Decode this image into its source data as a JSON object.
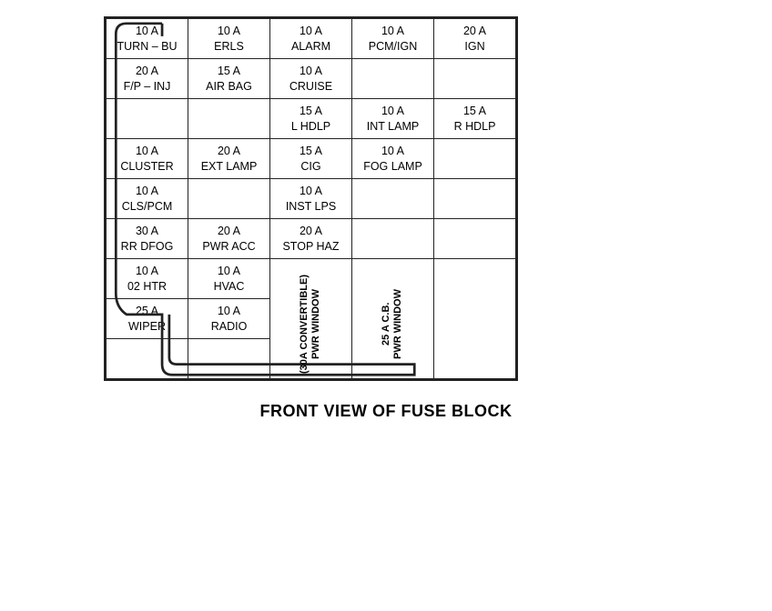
{
  "title": "FRONT VIEW OF FUSE BLOCK",
  "rows": [
    [
      {
        "text": "10 A\nTURN – BU",
        "rowspan": 1,
        "colspan": 1
      },
      {
        "text": "10 A\nERLS",
        "rowspan": 1,
        "colspan": 1
      },
      {
        "text": "10 A\nALARM",
        "rowspan": 1,
        "colspan": 1
      },
      {
        "text": "10 A\nPCM/IGN",
        "rowspan": 1,
        "colspan": 1
      },
      {
        "text": "20 A\nIGN",
        "rowspan": 1,
        "colspan": 1
      }
    ],
    [
      {
        "text": "20 A\nF/P – INJ",
        "rowspan": 1,
        "colspan": 1
      },
      {
        "text": "15 A\nAIR BAG",
        "rowspan": 1,
        "colspan": 1
      },
      {
        "text": "10 A\nCRUISE",
        "rowspan": 1,
        "colspan": 1
      },
      {
        "text": "",
        "rowspan": 1,
        "colspan": 1,
        "empty": true
      },
      {
        "text": "",
        "rowspan": 1,
        "colspan": 1,
        "empty": true
      }
    ],
    [
      {
        "text": "",
        "rowspan": 1,
        "colspan": 1,
        "empty": true
      },
      {
        "text": "",
        "rowspan": 1,
        "colspan": 1,
        "empty": true
      },
      {
        "text": "15 A\nL HDLP",
        "rowspan": 1,
        "colspan": 1
      },
      {
        "text": "10 A\nINT LAMP",
        "rowspan": 1,
        "colspan": 1
      },
      {
        "text": "15 A\nR HDLP",
        "rowspan": 1,
        "colspan": 1
      }
    ],
    [
      {
        "text": "10 A\nCLUSTER",
        "rowspan": 1,
        "colspan": 1
      },
      {
        "text": "20 A\nEXT LAMP",
        "rowspan": 1,
        "colspan": 1
      },
      {
        "text": "15 A\nCIG",
        "rowspan": 1,
        "colspan": 1
      },
      {
        "text": "10 A\nFOG LAMP",
        "rowspan": 1,
        "colspan": 1
      },
      {
        "text": "",
        "rowspan": 1,
        "colspan": 1,
        "empty": true
      }
    ],
    [
      {
        "text": "10 A\nCLS/PCM",
        "rowspan": 1,
        "colspan": 1
      },
      {
        "text": "",
        "rowspan": 1,
        "colspan": 1,
        "empty": true
      },
      {
        "text": "10 A\nINST LPS",
        "rowspan": 1,
        "colspan": 1
      },
      {
        "text": "",
        "rowspan": 1,
        "colspan": 1,
        "empty": true
      },
      {
        "text": "",
        "rowspan": 1,
        "colspan": 1,
        "empty": true
      }
    ],
    [
      {
        "text": "30 A\nRR DFOG",
        "rowspan": 1,
        "colspan": 1
      },
      {
        "text": "20 A\nPWR ACC",
        "rowspan": 1,
        "colspan": 1
      },
      {
        "text": "20 A\nSTOP HAZ",
        "rowspan": 1,
        "colspan": 1
      },
      {
        "text": "",
        "rowspan": 1,
        "colspan": 1,
        "empty": true
      },
      {
        "text": "",
        "rowspan": 1,
        "colspan": 1,
        "empty": true
      }
    ]
  ],
  "bottom_rows": {
    "col1_rows": [
      {
        "text": "10 A\n02 HTR"
      },
      {
        "text": "25 A\nWIPER"
      },
      {
        "text": ""
      }
    ],
    "col2_rows": [
      {
        "text": "10 A\nHVAC"
      },
      {
        "text": "10 A\nRADIO"
      },
      {
        "text": ""
      }
    ],
    "rotated_col": "(30A CONVERTIBLE)\nPWR WINDOW",
    "rotated_col2": "25 A C.B.\nPWR WINDOW",
    "empty_cols": 2
  }
}
